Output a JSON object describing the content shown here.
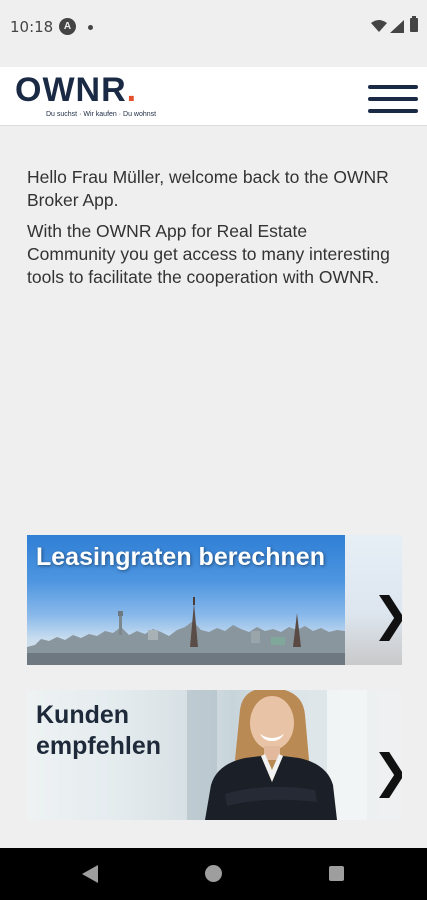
{
  "status_bar": {
    "time": "10:18",
    "icons": [
      "a-notification-icon",
      "dot-icon",
      "wifi-icon",
      "signal-icon",
      "battery-icon"
    ]
  },
  "header": {
    "logo_text": "OWNR",
    "logo_accent": ".",
    "tagline": "Du suchst · Wir kaufen · Du wohnst",
    "menu_icon": "hamburger-menu-icon",
    "brand_color": "#1b2a44",
    "accent_color": "#e5502d"
  },
  "welcome": {
    "greeting": "Hello Frau Müller, welcome back to the OWNR Broker App.",
    "description": "With the OWNR App for Real Estate Community you get access to many interesting tools to facilitate the cooperation with OWNR."
  },
  "cards": [
    {
      "title": "Leasingraten berechnen",
      "chevron": "❯",
      "icon": "chevron-right-icon"
    },
    {
      "title": "Kunden empfehlen",
      "chevron": "❯",
      "icon": "chevron-right-icon"
    }
  ],
  "nav_bar": {
    "icons": [
      "back-icon",
      "home-icon",
      "recents-icon"
    ]
  }
}
